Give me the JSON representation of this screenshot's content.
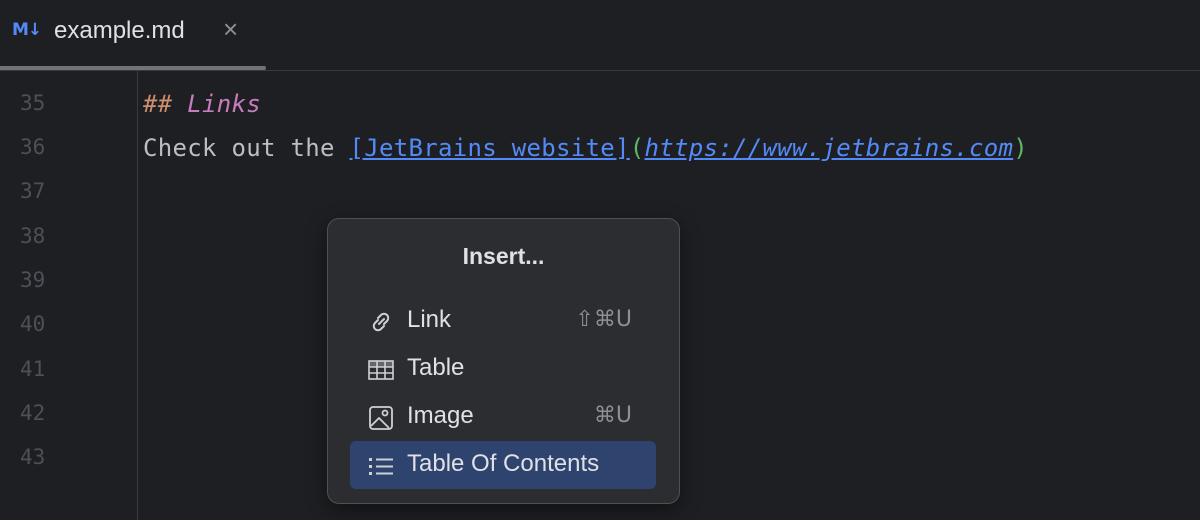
{
  "tab": {
    "icon": "markdown-icon",
    "icon_text": "M↓",
    "title": "example.md",
    "close": "×"
  },
  "editor": {
    "line_numbers": [
      "35",
      "36",
      "37",
      "38",
      "39",
      "40",
      "41",
      "42",
      "43"
    ],
    "line35": {
      "hash": "##",
      "heading": "Links"
    },
    "line36": {
      "prefix": "Check out the ",
      "link_text": "[JetBrains website]",
      "paren_open": "(",
      "url": "https://www.jetbrains.com",
      "paren_close": ")"
    }
  },
  "popup": {
    "title": "Insert...",
    "items": [
      {
        "label": "Link",
        "shortcut": "⇧⌘U",
        "icon": "link-icon",
        "selected": false
      },
      {
        "label": "Table",
        "shortcut": "",
        "icon": "table-icon",
        "selected": false
      },
      {
        "label": "Image",
        "shortcut": "⌘U",
        "icon": "image-icon",
        "selected": false
      },
      {
        "label": "Table Of Contents",
        "shortcut": "",
        "icon": "list-icon",
        "selected": true
      }
    ]
  },
  "colors": {
    "background": "#1e1f22",
    "popup_background": "#2b2d30",
    "selection": "#2e436e",
    "link": "#548af7",
    "heading": "#c77dbb",
    "heading_marker": "#cf8e6d",
    "paren": "#5fb865"
  }
}
